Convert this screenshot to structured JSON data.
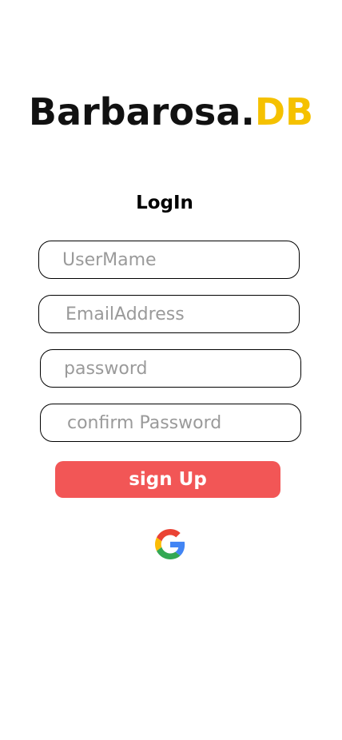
{
  "brand": {
    "name": "Barbarosa.",
    "accent": "DB",
    "accent_color": "#f5c100"
  },
  "form": {
    "heading": "LogIn",
    "fields": {
      "username": {
        "placeholder": "UserMame",
        "value": ""
      },
      "email": {
        "placeholder": "EmailAddress",
        "value": ""
      },
      "password": {
        "placeholder": "password",
        "value": ""
      },
      "confirm_password": {
        "placeholder": "confirm Password",
        "value": ""
      }
    },
    "submit_label": "sign Up",
    "submit_color": "#f25656"
  },
  "social": {
    "google_icon": "google-icon"
  }
}
